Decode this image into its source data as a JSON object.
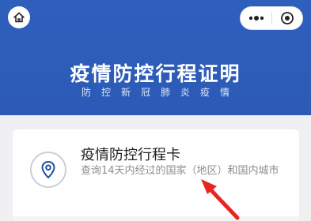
{
  "header": {
    "title": "疫情防控行程证明",
    "subtitle": "防控新冠肺炎疫情",
    "background_color": "#2f5fbd",
    "home_icon": "home-icon",
    "more_icon": "more-dots-icon",
    "close_icon": "target-circle-icon"
  },
  "card": {
    "title": "疫情防控行程卡",
    "description": "查询14天内经过的国家（地区）和国内城市",
    "icon": "location-pin-icon"
  },
  "annotation": {
    "arrow_color": "#e8261f",
    "arrow_icon": "red-arrow-icon"
  }
}
